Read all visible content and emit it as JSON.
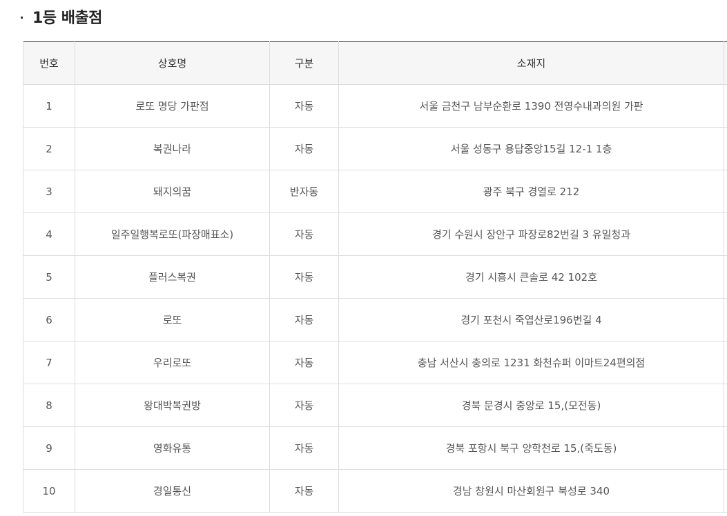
{
  "section": {
    "title": "1등 배출점"
  },
  "table": {
    "headers": {
      "no": "번호",
      "name": "상호명",
      "type": "구분",
      "address": "소재지"
    },
    "rows": [
      {
        "no": "1",
        "name": "로또 명당 가판점",
        "type": "자동",
        "address": "서울 금천구 남부순환로 1390 전영수내과의원 가판"
      },
      {
        "no": "2",
        "name": "복권나라",
        "type": "자동",
        "address": "서울 성동구 용답중앙15길 12-1 1층"
      },
      {
        "no": "3",
        "name": "돼지의꿈",
        "type": "반자동",
        "address": "광주 북구 경열로 212"
      },
      {
        "no": "4",
        "name": "일주일행복로또(파장매표소)",
        "type": "자동",
        "address": "경기 수원시 장안구 파장로82번길 3 유일청과"
      },
      {
        "no": "5",
        "name": "플러스복권",
        "type": "자동",
        "address": "경기 시흥시 큰솔로 42 102호"
      },
      {
        "no": "6",
        "name": "로또",
        "type": "자동",
        "address": "경기 포천시 죽엽산로196번길 4"
      },
      {
        "no": "7",
        "name": "우리로또",
        "type": "자동",
        "address": "충남 서산시 충의로 1231 화천슈퍼 이마트24편의점"
      },
      {
        "no": "8",
        "name": "왕대박복권방",
        "type": "자동",
        "address": "경북 문경시 중앙로 15,(모전동)"
      },
      {
        "no": "9",
        "name": "영화유통",
        "type": "자동",
        "address": "경북 포항시 북구 양학천로 15,(죽도동)"
      },
      {
        "no": "10",
        "name": "경일통신",
        "type": "자동",
        "address": "경남 창원시 마산회원구 북성로 340"
      }
    ]
  }
}
